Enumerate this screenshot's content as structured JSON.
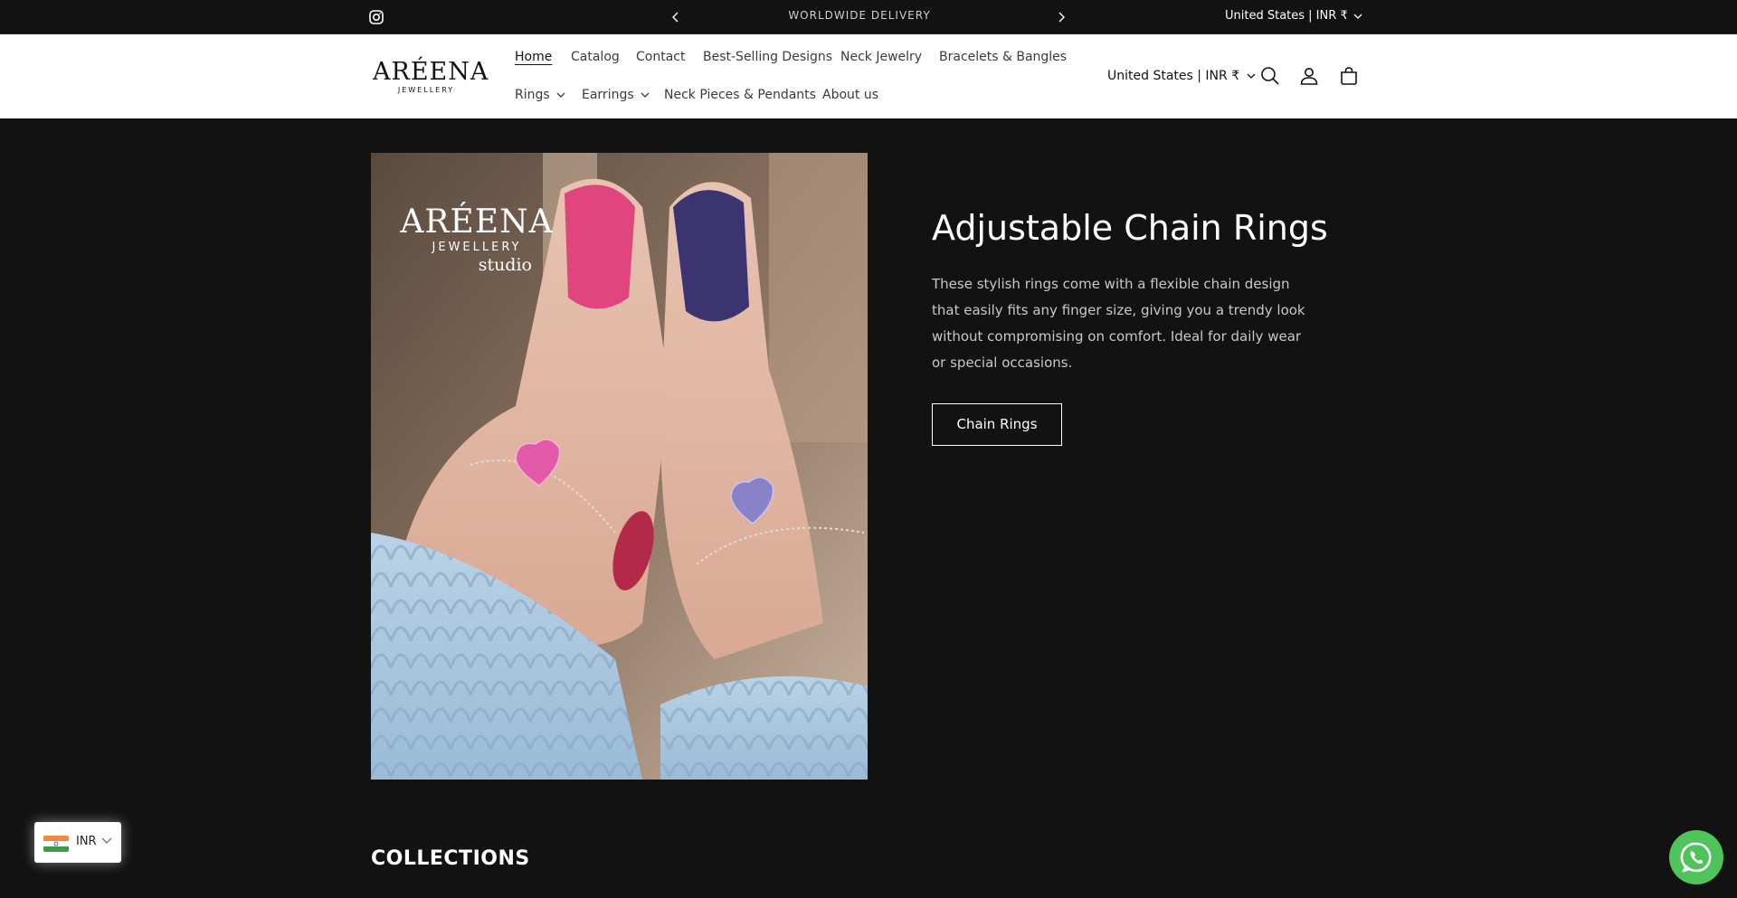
{
  "announcement": {
    "message": "WORLDWIDE DELIVERY",
    "country": "United States | INR ₹"
  },
  "header": {
    "logo": {
      "name": "ARÉENA",
      "sub": "JEWELLERY"
    },
    "nav_row1": [
      "Home",
      "Catalog",
      "Contact",
      "Best-Selling Designs",
      "Neck Jewelry",
      "Bracelets & Bangles"
    ],
    "nav_row2": [
      "Rings",
      "Earrings",
      "Neck Pieces & Pendants",
      "About us"
    ],
    "country": "United States | INR ₹"
  },
  "hero": {
    "image_logo": {
      "name": "ARÉENA",
      "sub": "JEWELLERY",
      "tag": "studio"
    },
    "title": "Adjustable Chain Rings",
    "description": "These stylish rings come with a flexible chain design that easily fits any finger size, giving you a trendy look without compromising on comfort. Ideal for daily wear or special occasions.",
    "button_label": "Chain Rings"
  },
  "collections_heading": "COLLECTIONS",
  "currency_widget": {
    "code": "INR"
  },
  "colors": {
    "background": "#121212",
    "header_bg": "#ffffff",
    "whatsapp": "#4ec45a"
  }
}
